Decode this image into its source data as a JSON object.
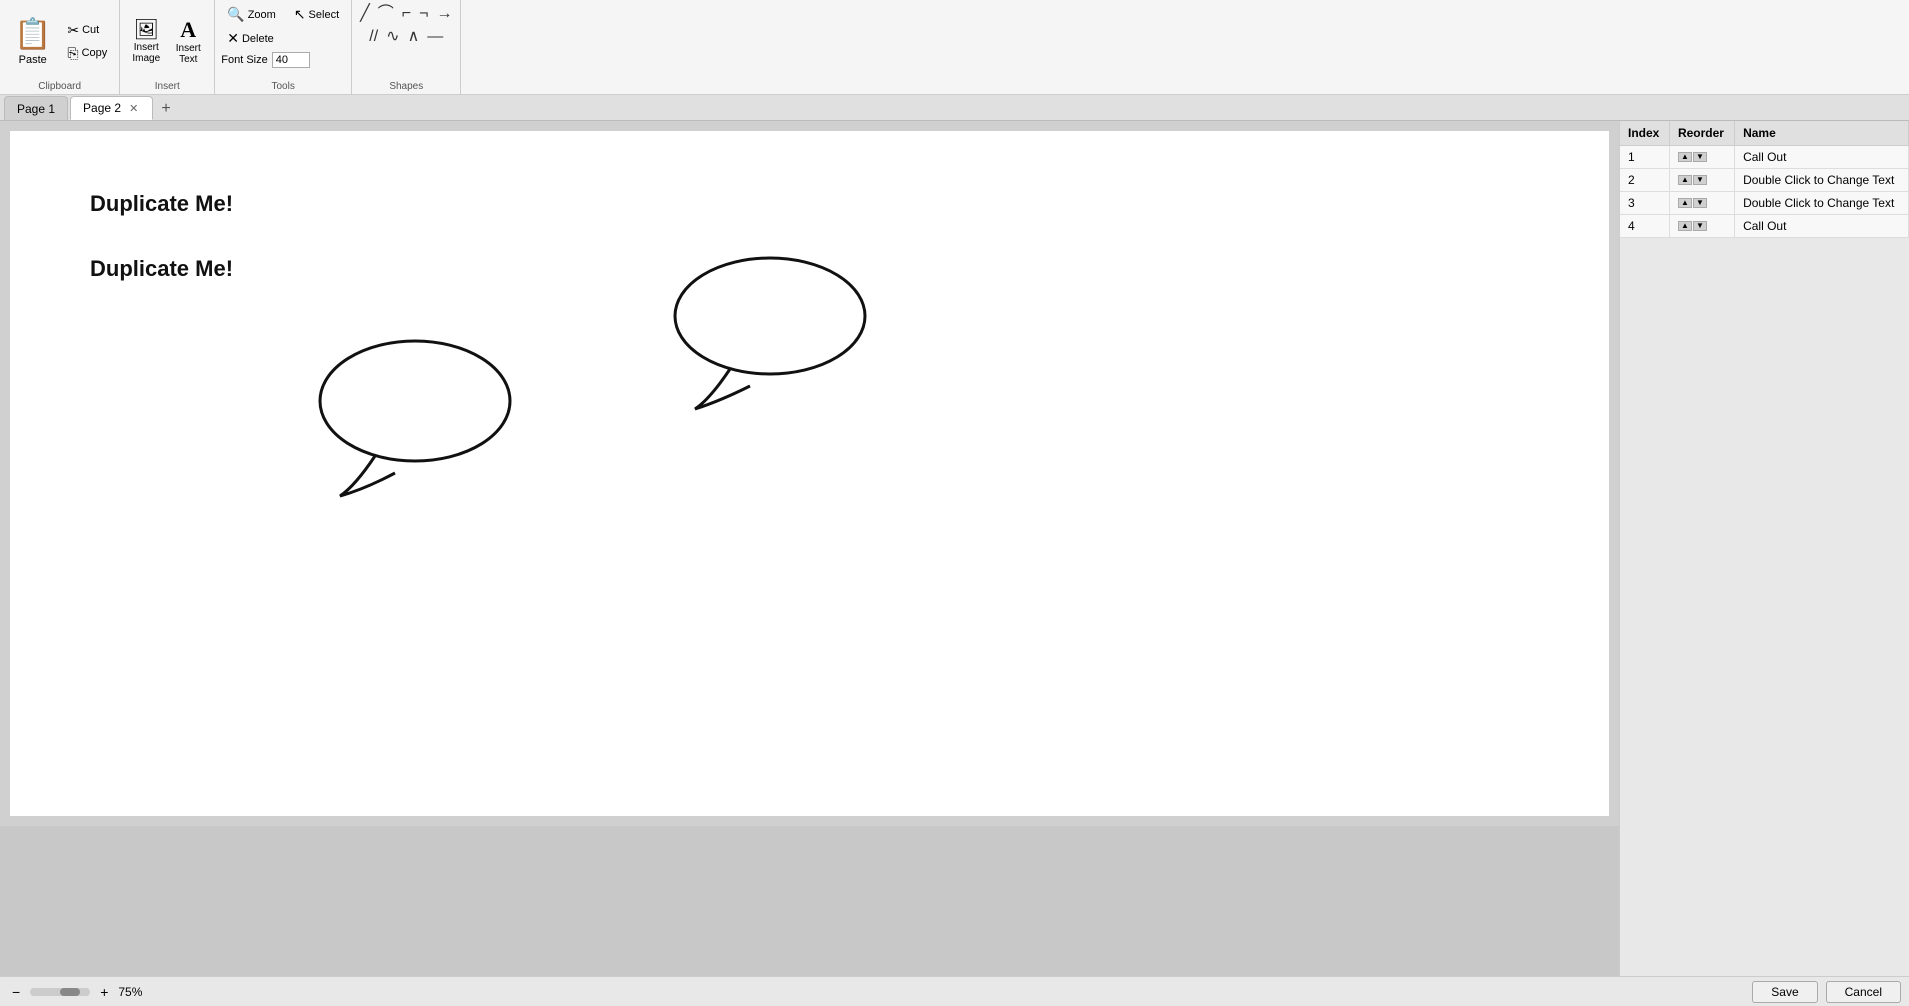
{
  "toolbar": {
    "groups": {
      "clipboard": {
        "label": "Clipboard",
        "paste_label": "Paste",
        "cut_label": "Cut",
        "copy_label": "Copy"
      },
      "insert": {
        "label": "Insert",
        "insert_image_label": "Insert\nImage",
        "insert_text_label": "Insert\nText"
      },
      "tools": {
        "label": "Tools",
        "zoom_label": "Zoom",
        "delete_label": "Delete",
        "select_label": "Select",
        "font_size_label": "Font Size",
        "font_size_value": "40"
      },
      "shapes": {
        "label": "Shapes"
      }
    }
  },
  "tabs": [
    {
      "label": "Page 1",
      "active": false,
      "closable": false
    },
    {
      "label": "Page 2",
      "active": true,
      "closable": true
    }
  ],
  "canvas": {
    "text1": "Duplicate Me!",
    "text2": "Duplicate Me!"
  },
  "right_panel": {
    "col_index": "Index",
    "col_reorder": "Reorder",
    "col_name": "Name",
    "rows": [
      {
        "index": "1",
        "name": "Call Out"
      },
      {
        "index": "2",
        "name": "Double Click to Change Text"
      },
      {
        "index": "3",
        "name": "Double Click to Change Text"
      },
      {
        "index": "4",
        "name": "Call Out"
      }
    ]
  },
  "bottom": {
    "zoom_value": "75%",
    "save_label": "Save",
    "cancel_label": "Cancel"
  }
}
